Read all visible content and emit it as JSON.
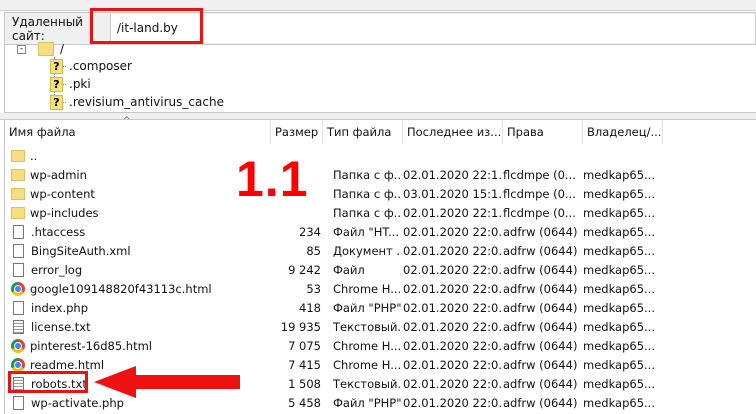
{
  "remote_site": {
    "label": "Удаленный сайт:",
    "value": "/it-land.by"
  },
  "tree": {
    "root": "/",
    "children": [
      ".composer",
      ".pki",
      ".revisium_antivirus_cache"
    ]
  },
  "columns": [
    "Имя файла",
    "Размер",
    "Тип файла",
    "Последнее из...",
    "Права",
    "Владелец/..."
  ],
  "rows": [
    {
      "icon": "folder",
      "name": "..",
      "size": "",
      "type": "",
      "date": "",
      "rights": "",
      "owner": ""
    },
    {
      "icon": "folder",
      "name": "wp-admin",
      "size": "",
      "type": "Папка с ф...",
      "date": "02.01.2020 22:1...",
      "rights": "flcdmpe (0...",
      "owner": "medkap65..."
    },
    {
      "icon": "folder",
      "name": "wp-content",
      "size": "",
      "type": "Папка с ф...",
      "date": "03.01.2020 15:1...",
      "rights": "flcdmpe (0...",
      "owner": "medkap65..."
    },
    {
      "icon": "folder",
      "name": "wp-includes",
      "size": "",
      "type": "Папка с ф...",
      "date": "02.01.2020 22:1...",
      "rights": "flcdmpe (0...",
      "owner": "medkap65..."
    },
    {
      "icon": "file",
      "name": ".htaccess",
      "size": "234",
      "type": "Файл \"HT...",
      "date": "02.01.2020 22:0...",
      "rights": "adfrw (0644)",
      "owner": "medkap65..."
    },
    {
      "icon": "file",
      "name": "BingSiteAuth.xml",
      "size": "85",
      "type": "Документ ...",
      "date": "02.01.2020 22:0...",
      "rights": "adfrw (0644)",
      "owner": "medkap65..."
    },
    {
      "icon": "file",
      "name": "error_log",
      "size": "9 242",
      "type": "Файл",
      "date": "02.01.2020 22:0...",
      "rights": "adfrw (0644)",
      "owner": "medkap65..."
    },
    {
      "icon": "chrome",
      "name": "google109148820f43113c.html",
      "size": "53",
      "type": "Chrome H...",
      "date": "02.01.2020 22:0...",
      "rights": "adfrw (0644)",
      "owner": "medkap65..."
    },
    {
      "icon": "file",
      "name": "index.php",
      "size": "418",
      "type": "Файл \"PHP\"",
      "date": "02.01.2020 22:0...",
      "rights": "adfrw (0644)",
      "owner": "medkap65..."
    },
    {
      "icon": "txt",
      "name": "license.txt",
      "size": "19 935",
      "type": "Текстовый...",
      "date": "02.01.2020 22:0...",
      "rights": "adfrw (0644)",
      "owner": "medkap65..."
    },
    {
      "icon": "chrome",
      "name": "pinterest-16d85.html",
      "size": "7 075",
      "type": "Chrome H...",
      "date": "02.01.2020 22:0...",
      "rights": "adfrw (0644)",
      "owner": "medkap65..."
    },
    {
      "icon": "chrome",
      "name": "readme.html",
      "size": "7 415",
      "type": "Chrome H...",
      "date": "02.01.2020 22:0...",
      "rights": "adfrw (0644)",
      "owner": "medkap65..."
    },
    {
      "icon": "txt",
      "name": "robots.txt",
      "size": "1 508",
      "type": "Текстовый...",
      "date": "02.01.2020 22:0...",
      "rights": "adfrw (0644)",
      "owner": "medkap65..."
    },
    {
      "icon": "file",
      "name": "wp-activate.php",
      "size": "5 458",
      "type": "Файл \"PHP\"",
      "date": "02.01.2020 22:0...",
      "rights": "adfrw (0644)",
      "owner": "medkap65..."
    }
  ],
  "annotation": {
    "step": "1.1",
    "color": "#ff0000"
  }
}
